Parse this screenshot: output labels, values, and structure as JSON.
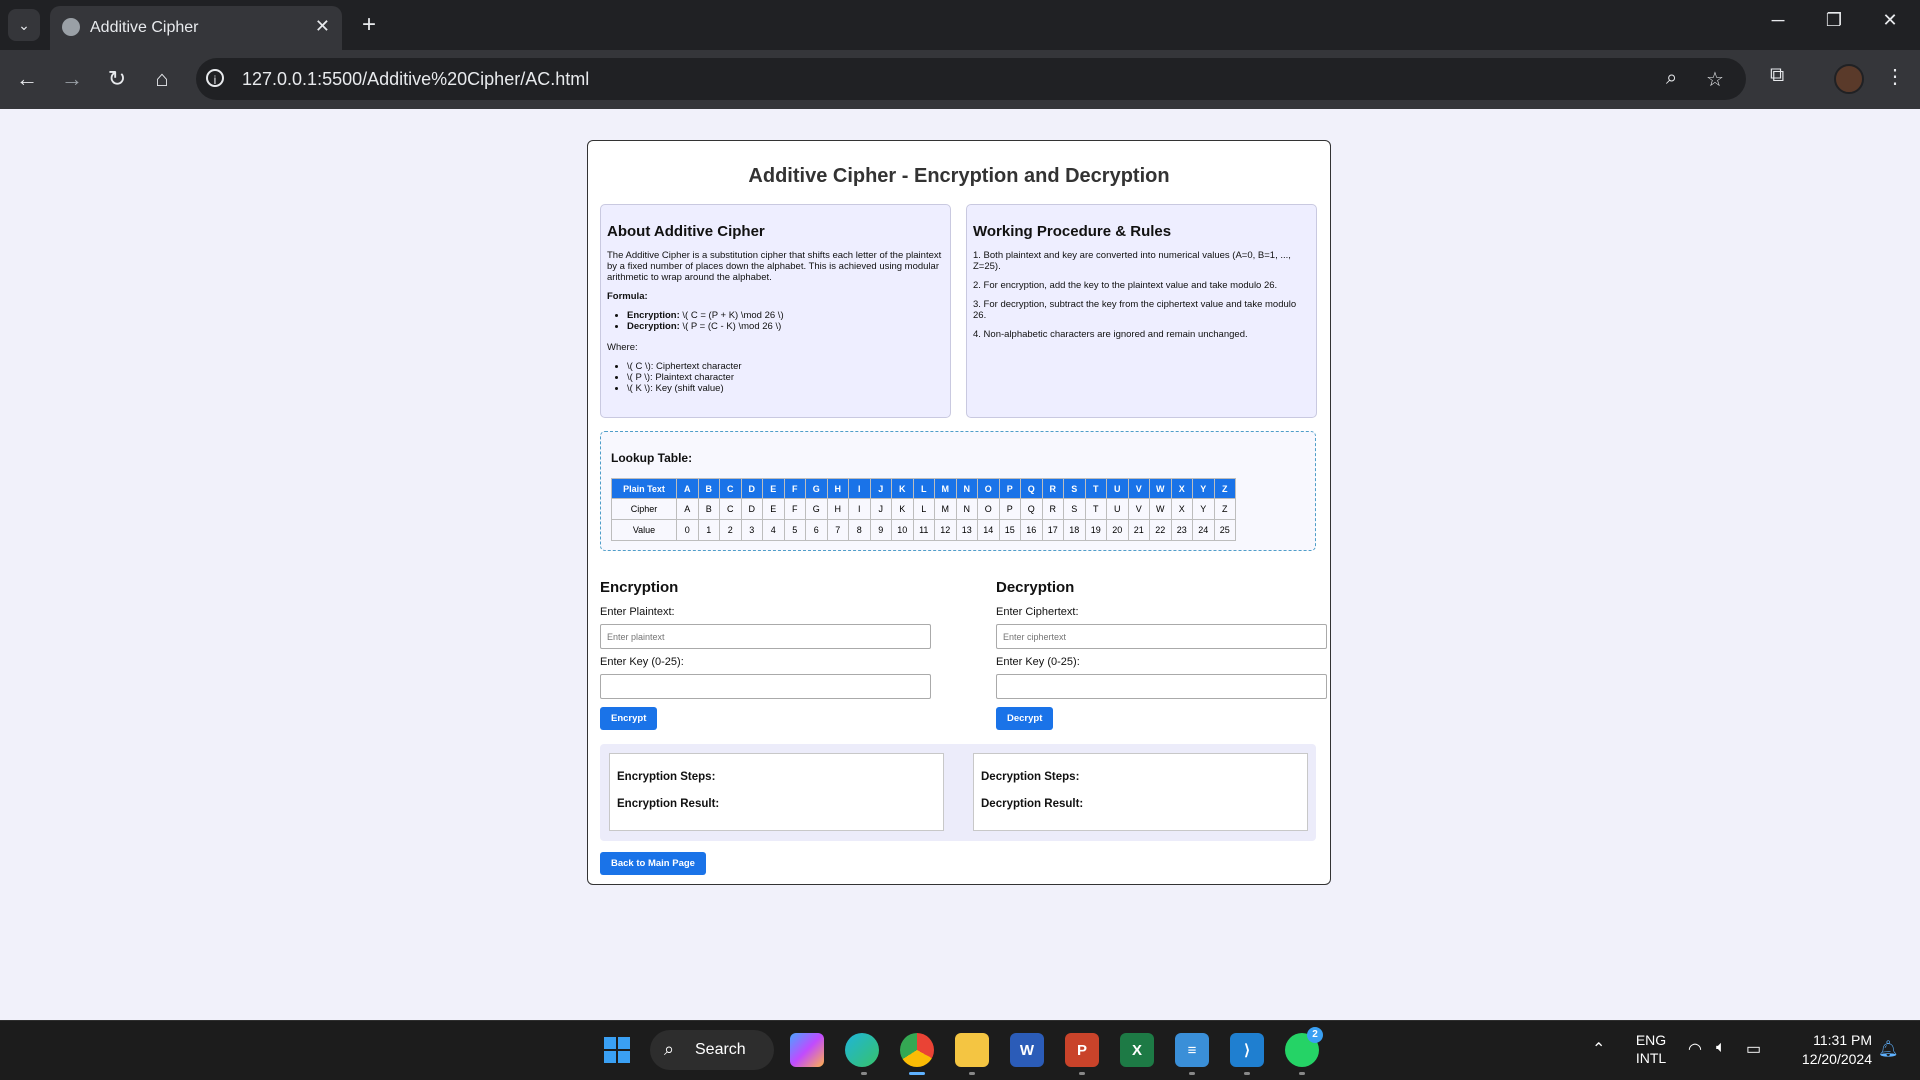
{
  "browser": {
    "tab_title": "Additive Cipher",
    "url": "127.0.0.1:5500/Additive%20Cipher/AC.html"
  },
  "page": {
    "title": "Additive Cipher - Encryption and Decryption",
    "about": {
      "heading": "About Additive Cipher",
      "description": "The Additive Cipher is a substitution cipher that shifts each letter of the plaintext by a fixed number of places down the alphabet. This is achieved using modular arithmetic to wrap around the alphabet.",
      "formula_label": "Formula:",
      "formulas": [
        {
          "name": "Encryption:",
          "expr": "\\( C = (P + K) \\mod 26 \\)"
        },
        {
          "name": "Decryption:",
          "expr": "\\( P = (C - K) \\mod 26 \\)"
        }
      ],
      "where_label": "Where:",
      "where_items": [
        "\\( C \\): Ciphertext character",
        "\\( P \\): Plaintext character",
        "\\( K \\): Key (shift value)"
      ]
    },
    "procedure": {
      "heading": "Working Procedure & Rules",
      "steps": [
        "1. Both plaintext and key are converted into numerical values (A=0, B=1, ..., Z=25).",
        "2. For encryption, add the key to the plaintext value and take modulo 26.",
        "3. For decryption, subtract the key from the ciphertext value and take modulo 26.",
        "4. Non-alphabetic characters are ignored and remain unchanged."
      ]
    },
    "lookup": {
      "heading": "Lookup Table:",
      "row_labels": [
        "Plain Text",
        "Cipher",
        "Value"
      ],
      "letters": [
        "A",
        "B",
        "C",
        "D",
        "E",
        "F",
        "G",
        "H",
        "I",
        "J",
        "K",
        "L",
        "M",
        "N",
        "O",
        "P",
        "Q",
        "R",
        "S",
        "T",
        "U",
        "V",
        "W",
        "X",
        "Y",
        "Z"
      ],
      "values": [
        "0",
        "1",
        "2",
        "3",
        "4",
        "5",
        "6",
        "7",
        "8",
        "9",
        "10",
        "11",
        "12",
        "13",
        "14",
        "15",
        "16",
        "17",
        "18",
        "19",
        "20",
        "21",
        "22",
        "23",
        "24",
        "25"
      ]
    },
    "encryption": {
      "heading": "Encryption",
      "plaintext_label": "Enter Plaintext:",
      "plaintext_placeholder": "Enter plaintext",
      "key_label": "Enter Key (0-25):",
      "button": "Encrypt"
    },
    "decryption": {
      "heading": "Decryption",
      "ciphertext_label": "Enter Ciphertext:",
      "ciphertext_placeholder": "Enter ciphertext",
      "key_label": "Enter Key (0-25):",
      "button": "Decrypt"
    },
    "results": {
      "enc_steps_label": "Encryption Steps:",
      "enc_result_label": "Encryption Result:",
      "dec_steps_label": "Decryption Steps:",
      "dec_result_label": "Decryption Result:"
    },
    "back_button": "Back to Main Page"
  },
  "taskbar": {
    "search_label": "Search",
    "whatsapp_badge": "2",
    "lang_line1": "ENG",
    "lang_line2": "INTL",
    "time": "11:31 PM",
    "date": "12/20/2024"
  }
}
